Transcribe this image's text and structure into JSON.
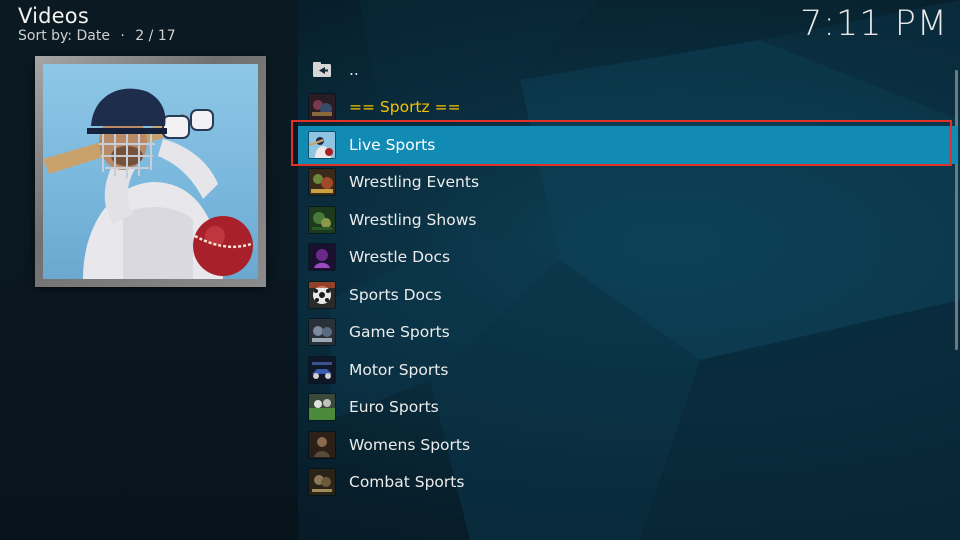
{
  "header": {
    "title": "Videos",
    "sort_label": "Sort by: Date",
    "position": "2 / 17",
    "separator": "·"
  },
  "clock": "7:11 PM",
  "thumbnail": {
    "icon": "cricket-batsman-image"
  },
  "list": {
    "items": [
      {
        "label": "..",
        "icon": "back-folder-icon",
        "type": "parent"
      },
      {
        "label": "== Sportz ==",
        "icon": "sportz-icon",
        "type": "heading"
      },
      {
        "label": "Live Sports",
        "icon": "live-sports-icon",
        "type": "item",
        "selected": true
      },
      {
        "label": "Wrestling Events",
        "icon": "wrestling-events-icon",
        "type": "item"
      },
      {
        "label": "Wrestling Shows",
        "icon": "wrestling-shows-icon",
        "type": "item"
      },
      {
        "label": "Wrestle Docs",
        "icon": "wrestle-docs-icon",
        "type": "item"
      },
      {
        "label": "Sports Docs",
        "icon": "sports-docs-icon",
        "type": "item"
      },
      {
        "label": "Game Sports",
        "icon": "game-sports-icon",
        "type": "item"
      },
      {
        "label": "Motor Sports",
        "icon": "motor-sports-icon",
        "type": "item"
      },
      {
        "label": "Euro Sports",
        "icon": "euro-sports-icon",
        "type": "item"
      },
      {
        "label": "Womens Sports",
        "icon": "womens-sports-icon",
        "type": "item"
      },
      {
        "label": "Combat Sports",
        "icon": "combat-sports-icon",
        "type": "item"
      }
    ]
  },
  "colors": {
    "selected_row": "#118ab4",
    "heading_text": "#f5c200",
    "selection_outline": "#e0322b"
  }
}
